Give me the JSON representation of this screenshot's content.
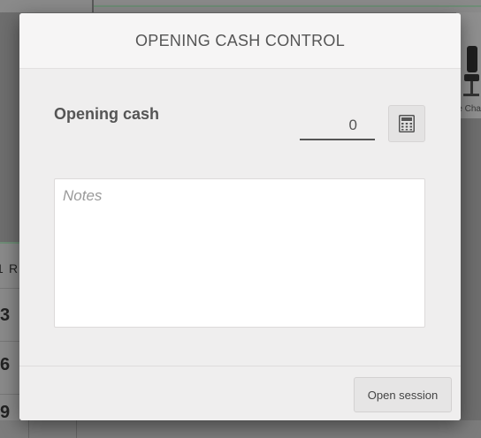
{
  "background": {
    "product_label": "e Cha",
    "numpad_column_header": "R",
    "numpad_row_prefix": "1",
    "numpad_keys": [
      "3",
      "6",
      "9"
    ]
  },
  "modal": {
    "title": "OPENING CASH CONTROL",
    "opening_cash": {
      "label": "Opening cash",
      "value": "0",
      "calculator_icon": "calculator-icon"
    },
    "notes": {
      "placeholder": "Notes",
      "value": ""
    },
    "footer": {
      "open_session_label": "Open session"
    }
  },
  "colors": {
    "backdrop": "#6e6e6e",
    "modal_bg": "#efeeee",
    "header_bg": "#f6f5f5",
    "title_text": "#555555",
    "accent_green": "#6f8d77"
  }
}
